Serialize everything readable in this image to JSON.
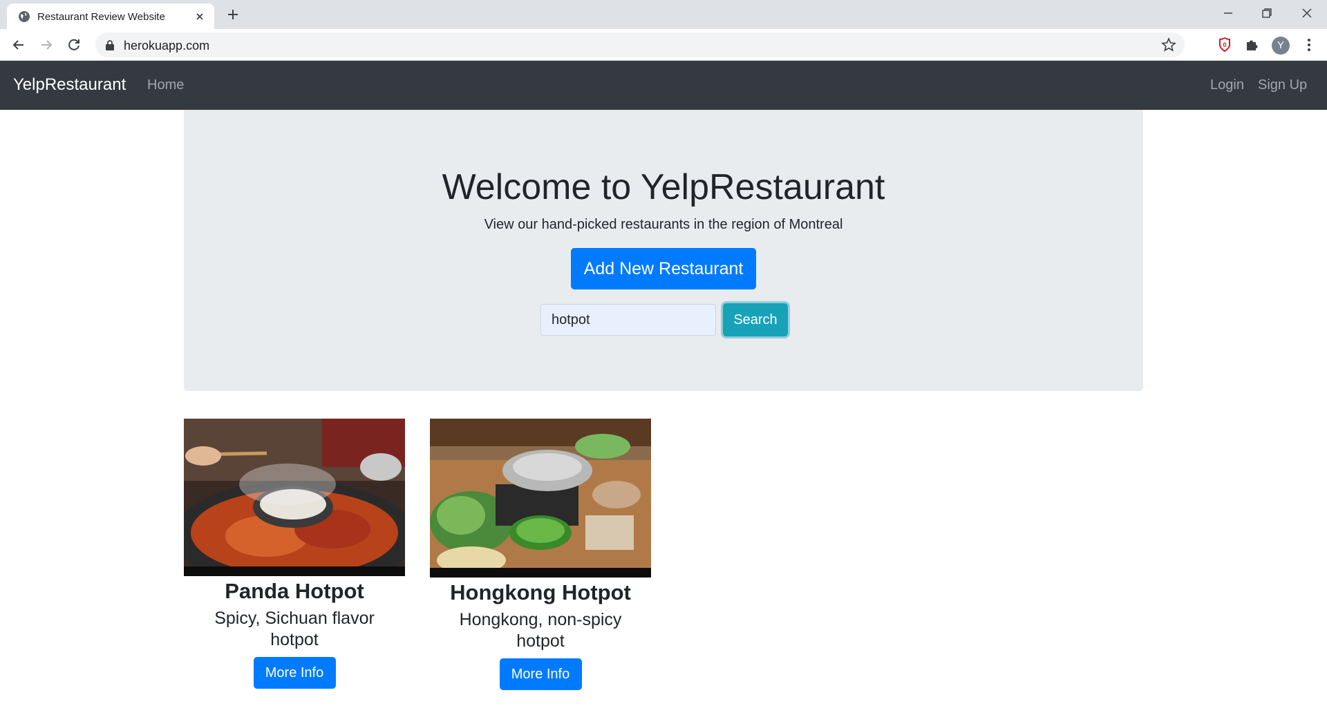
{
  "browser": {
    "tab_title": "Restaurant Review Website",
    "url": "herokuapp.com",
    "profile_initial": "Y"
  },
  "navbar": {
    "brand": "YelpRestaurant",
    "home": "Home",
    "login": "Login",
    "signup": "Sign Up"
  },
  "hero": {
    "title": "Welcome to YelpRestaurant",
    "subtitle": "View our hand-picked restaurants in the region of Montreal",
    "add_button": "Add New Restaurant",
    "search_value": "hotpot",
    "search_button": "Search"
  },
  "restaurants": [
    {
      "name": "Panda Hotpot",
      "description": "Spicy, Sichuan flavor hotpot",
      "button": "More Info"
    },
    {
      "name": "Hongkong Hotpot",
      "description": "Hongkong, non-spicy hotpot",
      "button": "More Info"
    }
  ],
  "colors": {
    "navbar_bg": "#343a40",
    "jumbotron_bg": "#e9ecef",
    "primary": "#007bff",
    "info": "#17a2b8"
  }
}
